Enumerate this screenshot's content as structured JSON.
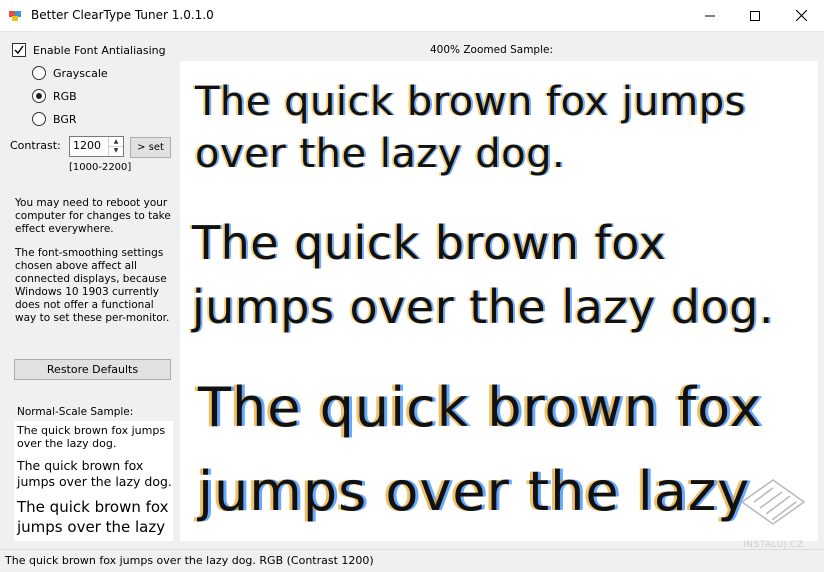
{
  "window": {
    "title": "Better ClearType Tuner 1.0.1.0",
    "controls": {
      "minimize": "minimize",
      "maximize": "maximize",
      "close": "close"
    }
  },
  "settings": {
    "antialias_label": "Enable Font Antialiasing",
    "antialias_checked": true,
    "modes": [
      {
        "label": "Grayscale",
        "selected": false
      },
      {
        "label": "RGB",
        "selected": true
      },
      {
        "label": "BGR",
        "selected": false
      }
    ],
    "contrast_label": "Contrast:",
    "contrast_value": "1200",
    "set_button": "> set",
    "range_hint": "[1000-2200]"
  },
  "info": {
    "reboot_note": "You may need to reboot your computer for changes to take effect everywhere.",
    "monitor_note": "The font-smoothing settings chosen above affect all connected displays, because Windows 10 1903 currently does not offer a functional way to set these per-monitor."
  },
  "restore_button": "Restore Defaults",
  "normal_sample": {
    "label": "Normal-Scale Sample:",
    "lines": [
      "The quick brown fox jumps over the lazy dog.",
      "The quick brown fox jumps over the lazy dog.",
      "The quick brown fox jumps over the lazy"
    ]
  },
  "zoom_sample": {
    "label": "400% Zoomed Sample:",
    "block1": [
      "The quick brown fox jumps",
      "over the lazy dog."
    ],
    "block2": [
      "The quick brown fox",
      "jumps over the lazy dog."
    ],
    "block3": [
      "The quick brown fox",
      "jumps over the lazy"
    ]
  },
  "watermark": "INSTALUJ.CZ",
  "status": "The quick brown fox jumps over the lazy dog. RGB (Contrast 1200)",
  "colors": {
    "window_bg": "#f0f0f0",
    "sample_bg": "#ffffff",
    "button_bg": "#e1e1e1"
  }
}
